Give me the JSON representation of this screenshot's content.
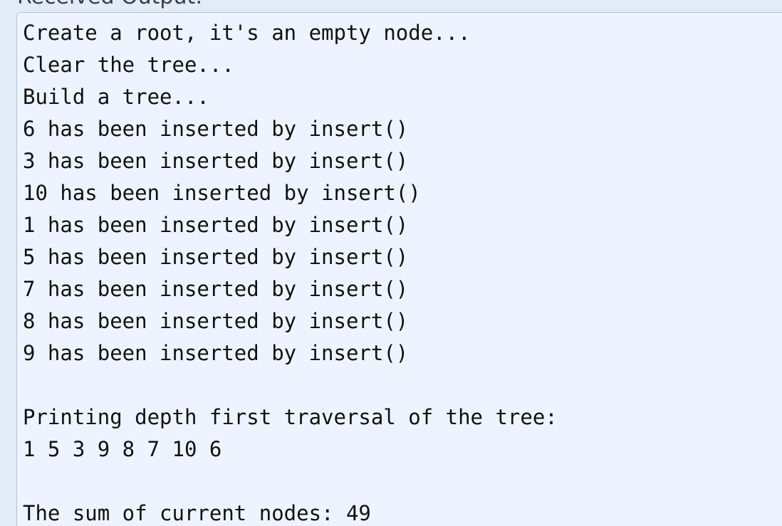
{
  "section": {
    "label": "Received Output:"
  },
  "output": {
    "lines": [
      "Create a root, it's an empty node...",
      "Clear the tree...",
      "Build a tree...",
      "6 has been inserted by insert()",
      "3 has been inserted by insert()",
      "10 has been inserted by insert()",
      "1 has been inserted by insert()",
      "5 has been inserted by insert()",
      "7 has been inserted by insert()",
      "8 has been inserted by insert()",
      "9 has been inserted by insert()",
      "",
      "Printing depth first traversal of the tree:",
      "1 5 3 9 8 7 10 6",
      "",
      "The sum of current nodes: 49"
    ]
  }
}
